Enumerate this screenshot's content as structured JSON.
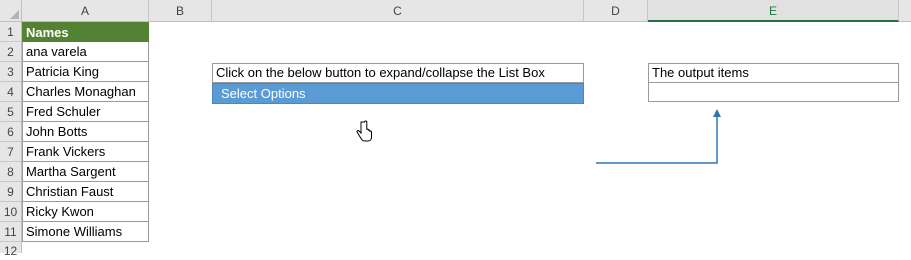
{
  "columns": [
    "A",
    "B",
    "C",
    "D",
    "E"
  ],
  "rows": [
    "1",
    "2",
    "3",
    "4",
    "5",
    "6",
    "7",
    "8",
    "9",
    "10",
    "11",
    "12"
  ],
  "names_header": "Names",
  "names": [
    "ana varela",
    "Patricia King",
    "Charles Monaghan",
    "Fred Schuler",
    "John Botts",
    "Frank Vickers",
    "Martha Sargent",
    "Christian Faust",
    "Ricky Kwon",
    "Simone Williams"
  ],
  "instruction": "Click on the below button to expand/collapse the List Box",
  "select_button": "Select Options",
  "output_label": "The output items",
  "output_value": "",
  "colors": {
    "header_green": "#548235",
    "button_blue": "#5b9bd5",
    "arrow_blue": "#2e75b6",
    "selected_col": "#217346"
  }
}
